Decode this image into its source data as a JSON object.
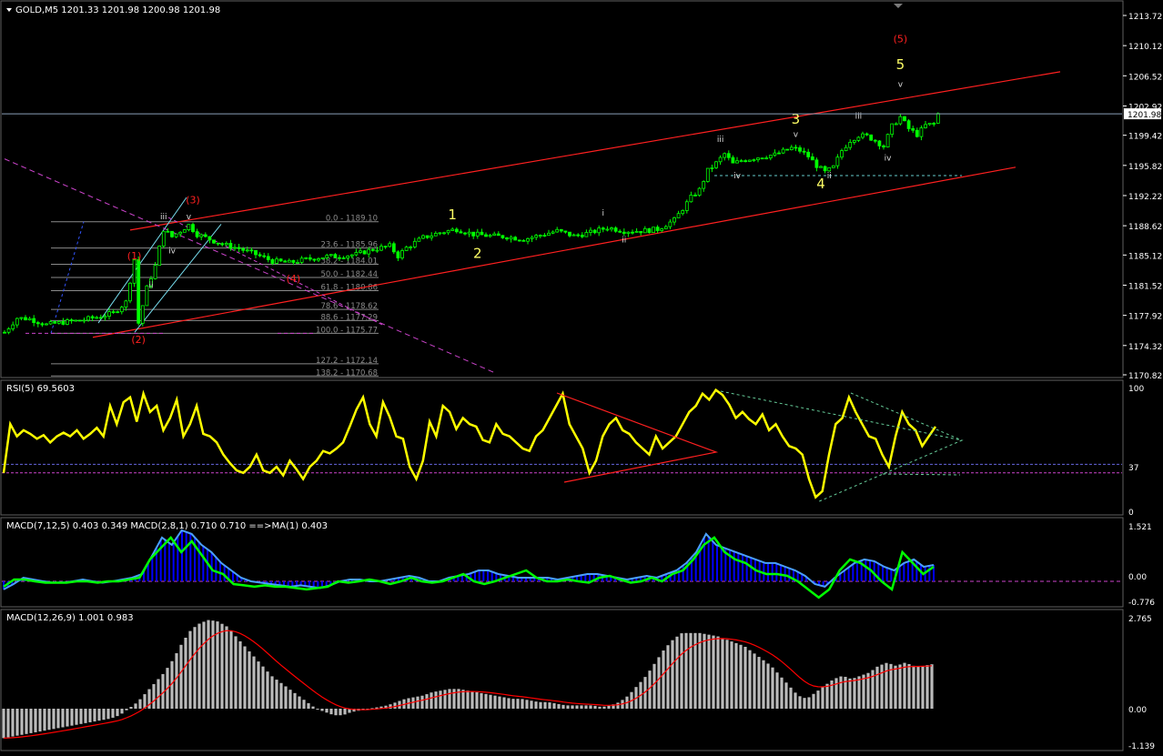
{
  "symbol_header": "GOLD,M5  1201.33 1201.98 1200.98 1201.98",
  "current_price_label": "1201.98",
  "colors": {
    "background": "#000000",
    "grid": "#1a1a1a",
    "axis_text": "#ffffff",
    "candle": "#00ff00",
    "channel": "#ff2020",
    "wave_major": "#ffff66",
    "wave_minor": "#dddddd",
    "wave_red": "#ff2020",
    "fib": "#8a8a8a",
    "magenta_dash": "#cc44cc",
    "rsi_line": "#ffff00",
    "macd_hist_blue": "#0000ff",
    "macd_line_green": "#00ff00",
    "macd_signal_light": "#4aa0ff",
    "osma_bar": "#bbbbbb",
    "signal_red": "#ff0000"
  },
  "price_axis": [
    "1213.72",
    "1210.12",
    "1206.52",
    "1202.92",
    "1199.42",
    "1195.82",
    "1192.22",
    "1188.62",
    "1185.12",
    "1181.52",
    "1177.92",
    "1174.32",
    "1170.82"
  ],
  "fib_levels": [
    {
      "label": "0.0 - 1189.10",
      "price": 1189.1
    },
    {
      "label": "23.6 - 1185.96",
      "price": 1185.96
    },
    {
      "label": "38.2 - 1184.01",
      "price": 1184.01
    },
    {
      "label": "50.0 - 1182.44",
      "price": 1182.44
    },
    {
      "label": "61.8 - 1180.86",
      "price": 1180.86
    },
    {
      "label": "78.6 - 1178.62",
      "price": 1178.62
    },
    {
      "label": "88.6 - 1177.29",
      "price": 1177.29
    },
    {
      "label": "100.0 - 1175.77",
      "price": 1175.77
    },
    {
      "label": "127.2 - 1172.14",
      "price": 1172.14
    },
    {
      "label": "138.2 - 1170.68",
      "price": 1170.68
    }
  ],
  "wave_labels": [
    {
      "text": "(1)",
      "price": 1184.6,
      "bar": 31,
      "kind": "red"
    },
    {
      "text": "(2)",
      "price": 1174.6,
      "bar": 32,
      "kind": "red"
    },
    {
      "text": "(3)",
      "price": 1191.3,
      "bar": 45,
      "kind": "red"
    },
    {
      "text": "(4)",
      "price": 1181.9,
      "bar": 69,
      "kind": "red"
    },
    {
      "text": "(5)",
      "price": 1210.5,
      "bar": 214,
      "kind": "red"
    },
    {
      "text": "1",
      "price": 1189.4,
      "bar": 107,
      "kind": "major"
    },
    {
      "text": "2",
      "price": 1184.8,
      "bar": 113,
      "kind": "major"
    },
    {
      "text": "3",
      "price": 1200.8,
      "bar": 189,
      "kind": "major"
    },
    {
      "text": "4",
      "price": 1193.1,
      "bar": 195,
      "kind": "major"
    },
    {
      "text": "5",
      "price": 1207.3,
      "bar": 214,
      "kind": "major"
    },
    {
      "text": "i",
      "price": 1189.8,
      "bar": 143,
      "kind": "minor"
    },
    {
      "text": "ii",
      "price": 1186.6,
      "bar": 148,
      "kind": "minor"
    },
    {
      "text": "iii",
      "price": 1198.6,
      "bar": 171,
      "kind": "minor"
    },
    {
      "text": "iv",
      "price": 1194.3,
      "bar": 175,
      "kind": "minor"
    },
    {
      "text": "v",
      "price": 1199.2,
      "bar": 189,
      "kind": "minor"
    },
    {
      "text": "ii",
      "price": 1194.3,
      "bar": 197,
      "kind": "minor"
    },
    {
      "text": "iii",
      "price": 1201.4,
      "bar": 204,
      "kind": "minor"
    },
    {
      "text": "iv",
      "price": 1196.4,
      "bar": 211,
      "kind": "minor"
    },
    {
      "text": "v",
      "price": 1205.2,
      "bar": 214,
      "kind": "minor"
    },
    {
      "text": "iii",
      "price": 1189.4,
      "bar": 38,
      "kind": "minor"
    },
    {
      "text": "v",
      "price": 1189.4,
      "bar": 44,
      "kind": "minor"
    },
    {
      "text": "iv",
      "price": 1185.3,
      "bar": 40,
      "kind": "minor"
    },
    {
      "text": "ii",
      "price": 1181.2,
      "bar": 35,
      "kind": "minor"
    }
  ],
  "rsi": {
    "title": "RSI(5) 69.5603",
    "levels_shown": [
      "100",
      "37",
      "0"
    ]
  },
  "macd_fast": {
    "title": "MACD(7,12,5) 0.403 0.349  MACD(2,8,1) 0.710 0.710  ==>MA(1) 0.403",
    "axis": [
      "1.521",
      "0.00",
      "-0.776"
    ]
  },
  "macd_slow": {
    "title": "MACD(12,26,9) 1.001 0.983",
    "axis": [
      "2.765",
      "0.00",
      "-1.139"
    ]
  },
  "chart_data": [
    {
      "type": "candlestick",
      "title": "GOLD,M5",
      "ylim": [
        1170.82,
        1213.72
      ],
      "ohlc_last": {
        "open": 1201.33,
        "high": 1201.98,
        "low": 1200.98,
        "close": 1201.98
      },
      "close_path": [
        [
          0,
          1175.9
        ],
        [
          3,
          1177.6
        ],
        [
          6,
          1177.5
        ],
        [
          10,
          1176.8
        ],
        [
          14,
          1177.1
        ],
        [
          18,
          1177.3
        ],
        [
          22,
          1177.7
        ],
        [
          26,
          1178.2
        ],
        [
          29,
          1179.5
        ],
        [
          31,
          1184.6
        ],
        [
          32,
          1177.0
        ],
        [
          34,
          1181.2
        ],
        [
          36,
          1183.8
        ],
        [
          38,
          1188.2
        ],
        [
          40,
          1187.3
        ],
        [
          42,
          1188.0
        ],
        [
          44,
          1188.7
        ],
        [
          46,
          1187.6
        ],
        [
          48,
          1187.2
        ],
        [
          52,
          1186.4
        ],
        [
          56,
          1185.9
        ],
        [
          60,
          1185.2
        ],
        [
          64,
          1184.4
        ],
        [
          68,
          1184.2
        ],
        [
          72,
          1184.6
        ],
        [
          76,
          1184.9
        ],
        [
          80,
          1185.0
        ],
        [
          84,
          1185.2
        ],
        [
          88,
          1185.8
        ],
        [
          92,
          1186.2
        ],
        [
          94,
          1185.0
        ],
        [
          96,
          1186.0
        ],
        [
          100,
          1187.2
        ],
        [
          104,
          1187.8
        ],
        [
          108,
          1188.2
        ],
        [
          112,
          1187.6
        ],
        [
          116,
          1187.4
        ],
        [
          120,
          1187.3
        ],
        [
          124,
          1187.0
        ],
        [
          128,
          1187.5
        ],
        [
          132,
          1188.0
        ],
        [
          136,
          1187.4
        ],
        [
          140,
          1187.8
        ],
        [
          144,
          1188.4
        ],
        [
          148,
          1188.0
        ],
        [
          152,
          1188.0
        ],
        [
          156,
          1188.2
        ],
        [
          160,
          1189.3
        ],
        [
          164,
          1192.0
        ],
        [
          166,
          1192.9
        ],
        [
          168,
          1195.2
        ],
        [
          170,
          1196.1
        ],
        [
          172,
          1197.2
        ],
        [
          174,
          1196.0
        ],
        [
          176,
          1196.4
        ],
        [
          180,
          1196.8
        ],
        [
          184,
          1197.1
        ],
        [
          188,
          1197.9
        ],
        [
          190,
          1197.6
        ],
        [
          192,
          1196.9
        ],
        [
          194,
          1195.8
        ],
        [
          196,
          1195.0
        ],
        [
          198,
          1195.6
        ],
        [
          200,
          1197.6
        ],
        [
          202,
          1198.8
        ],
        [
          204,
          1199.4
        ],
        [
          206,
          1199.3
        ],
        [
          208,
          1198.8
        ],
        [
          210,
          1198.1
        ],
        [
          212,
          1200.5
        ],
        [
          214,
          1201.6
        ],
        [
          216,
          1200.2
        ],
        [
          218,
          1199.5
        ],
        [
          220,
          1200.6
        ],
        [
          222,
          1200.8
        ],
        [
          223,
          1201.98
        ]
      ],
      "channel_upper": [
        [
          30,
          1188.1
        ],
        [
          226,
          1207.0
        ]
      ],
      "channel_lower": [
        [
          20,
          1175.3
        ],
        [
          226,
          1195.6
        ]
      ],
      "magenta_descending": [
        [
          0,
          1196.6
        ],
        [
          110,
          1171.0
        ]
      ]
    },
    {
      "type": "line",
      "title": "RSI(5) 69.5603",
      "ylim": [
        0,
        100
      ],
      "levels": [
        37,
        30
      ],
      "values": [
        30,
        70,
        60,
        65,
        62,
        58,
        61,
        55,
        60,
        63,
        60,
        65,
        58,
        62,
        67,
        60,
        85,
        70,
        88,
        92,
        72,
        95,
        80,
        85,
        65,
        75,
        90,
        60,
        70,
        85,
        62,
        60,
        55,
        45,
        38,
        32,
        30,
        35,
        45,
        32,
        30,
        35,
        28,
        40,
        33,
        25,
        35,
        40,
        48,
        46,
        50,
        55,
        68,
        82,
        92,
        70,
        60,
        88,
        76,
        60,
        58,
        35,
        25,
        40,
        72,
        60,
        85,
        80,
        66,
        75,
        70,
        68,
        57,
        55,
        70,
        62,
        60,
        55,
        50,
        48,
        60,
        65,
        75,
        85,
        95,
        70,
        60,
        50,
        30,
        40,
        60,
        70,
        75,
        65,
        62,
        55,
        50,
        45,
        60,
        50,
        55,
        60,
        70,
        80,
        85,
        95,
        90,
        98,
        94,
        86,
        75,
        80,
        74,
        70,
        78,
        65,
        70,
        60,
        52,
        50,
        45,
        25,
        10,
        15,
        45,
        70,
        75,
        92,
        80,
        70,
        60,
        58,
        45,
        35,
        60,
        80,
        70,
        65,
        52,
        60,
        68
      ]
    },
    {
      "type": "bar",
      "title": "MACD(7,12,5)",
      "ylim": [
        -0.776,
        1.521
      ],
      "histogram": [
        -0.3,
        -0.1,
        0.1,
        0.05,
        0.0,
        -0.05,
        -0.05,
        0.0,
        0.05,
        0.0,
        -0.05,
        0.0,
        0.05,
        0.1,
        0.2,
        0.7,
        1.2,
        1.0,
        1.4,
        1.3,
        1.0,
        0.8,
        0.5,
        0.3,
        0.1,
        0.0,
        -0.05,
        -0.1,
        -0.15,
        -0.2,
        -0.15,
        -0.2,
        -0.25,
        -0.15,
        0.0,
        0.05,
        0.05,
        0.0,
        0.0,
        0.05,
        0.1,
        0.15,
        0.1,
        0.0,
        0.0,
        0.1,
        0.15,
        0.2,
        0.3,
        0.3,
        0.2,
        0.15,
        0.1,
        0.1,
        0.1,
        0.1,
        0.05,
        0.1,
        0.15,
        0.2,
        0.2,
        0.15,
        0.1,
        0.05,
        0.1,
        0.15,
        0.1,
        0.2,
        0.3,
        0.5,
        0.8,
        1.3,
        1.0,
        0.9,
        0.8,
        0.7,
        0.6,
        0.5,
        0.5,
        0.4,
        0.3,
        0.15,
        -0.1,
        -0.2,
        0.1,
        0.3,
        0.5,
        0.6,
        0.55,
        0.4,
        0.3,
        0.5,
        0.6,
        0.4,
        0.45
      ],
      "main_line": [
        -0.2,
        0.05,
        0.05,
        0.0,
        -0.05,
        -0.05,
        -0.05,
        0.0,
        0.0,
        -0.05,
        0.0,
        0.0,
        0.05,
        0.1,
        0.6,
        0.9,
        1.2,
        0.8,
        1.1,
        0.7,
        0.3,
        0.2,
        -0.1,
        -0.15,
        -0.2,
        -0.15,
        -0.2,
        -0.2,
        -0.25,
        -0.3,
        -0.25,
        -0.2,
        0.0,
        -0.05,
        0.0,
        0.05,
        0.0,
        -0.1,
        0.0,
        0.1,
        0.0,
        -0.05,
        0.0,
        0.1,
        0.2,
        0.0,
        -0.1,
        0.0,
        0.1,
        0.2,
        0.3,
        0.1,
        0.0,
        0.0,
        0.05,
        0.0,
        -0.05,
        0.1,
        0.15,
        0.05,
        -0.05,
        0.0,
        0.1,
        0.0,
        0.2,
        0.3,
        0.6,
        1.0,
        1.2,
        0.8,
        0.6,
        0.5,
        0.3,
        0.2,
        0.2,
        0.15,
        0.0,
        -0.3,
        -0.6,
        -0.3,
        0.3,
        0.6,
        0.5,
        0.3,
        0.0,
        -0.3,
        0.8,
        0.5,
        0.2,
        0.4
      ]
    },
    {
      "type": "bar",
      "title": "MACD(12,26,9)",
      "ylim": [
        -1.139,
        2.765
      ],
      "histogram": [
        -0.9,
        -0.85,
        -0.8,
        -0.75,
        -0.7,
        -0.65,
        -0.6,
        -0.55,
        -0.5,
        -0.45,
        -0.4,
        -0.35,
        -0.3,
        -0.2,
        0.0,
        0.2,
        0.5,
        0.8,
        1.1,
        1.5,
        2.0,
        2.4,
        2.6,
        2.7,
        2.65,
        2.5,
        2.2,
        1.9,
        1.6,
        1.3,
        1.0,
        0.8,
        0.6,
        0.4,
        0.2,
        0.0,
        -0.1,
        -0.2,
        -0.2,
        -0.1,
        -0.05,
        0.0,
        0.05,
        0.1,
        0.2,
        0.3,
        0.35,
        0.4,
        0.5,
        0.55,
        0.6,
        0.6,
        0.55,
        0.5,
        0.45,
        0.4,
        0.35,
        0.3,
        0.3,
        0.25,
        0.2,
        0.2,
        0.15,
        0.1,
        0.1,
        0.1,
        0.1,
        0.05,
        0.1,
        0.2,
        0.4,
        0.7,
        1.0,
        1.4,
        1.8,
        2.1,
        2.3,
        2.3,
        2.3,
        2.25,
        2.2,
        2.1,
        2.0,
        1.9,
        1.7,
        1.5,
        1.3,
        1.0,
        0.7,
        0.4,
        0.3,
        0.5,
        0.7,
        0.9,
        1.0,
        0.9,
        1.0,
        1.1,
        1.3,
        1.4,
        1.3,
        1.4,
        1.3,
        1.3,
        1.35
      ]
    }
  ]
}
